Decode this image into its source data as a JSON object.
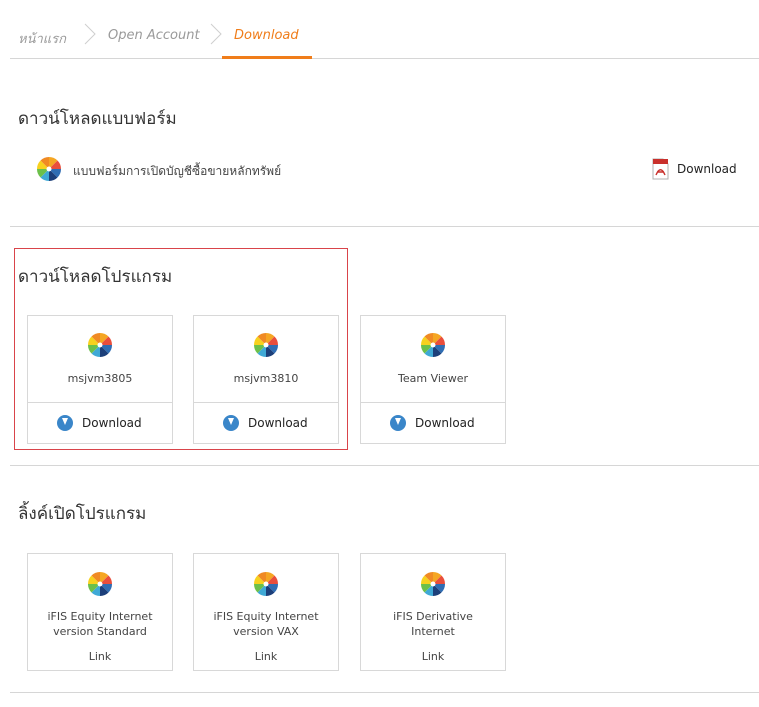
{
  "breadcrumb": {
    "items": [
      "หน้าแรก",
      "Open Account",
      "Download"
    ],
    "active_color": "#f07d1a"
  },
  "forms_section": {
    "title": "ดาวน์โหลดแบบฟอร์ม",
    "items": [
      {
        "label": "แบบฟอร์มการเปิดบัญชีซื้อขายหลักทรัพย์",
        "icon": "pdf-icon",
        "download_label": "Download"
      }
    ]
  },
  "programs_section": {
    "title": "ดาวน์โหลดโปรแกรม",
    "cards": [
      {
        "name": "msjvm3805",
        "download_label": "Download"
      },
      {
        "name": "msjvm3810",
        "download_label": "Download"
      },
      {
        "name": "Team Viewer",
        "download_label": "Download"
      }
    ]
  },
  "links_section": {
    "title": "ลิ้งค์เปิดโปรแกรม",
    "cards": [
      {
        "line1": "iFIS Equity Internet",
        "line2": "version Standard",
        "link_label": "Link"
      },
      {
        "line1": "iFIS Equity Internet",
        "line2": "version VAX",
        "link_label": "Link"
      },
      {
        "line1": "iFIS Derivative",
        "line2": "Internet",
        "link_label": "Link"
      }
    ]
  },
  "colors": {
    "highlight_border": "#d9444a",
    "download_icon": "#3a86c9"
  }
}
